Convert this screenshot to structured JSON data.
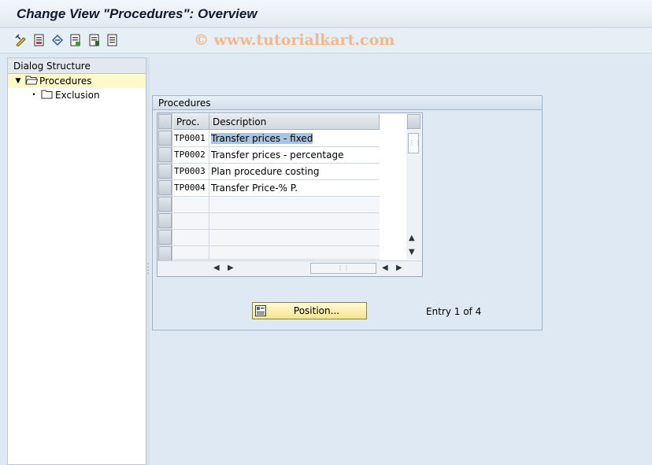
{
  "window": {
    "title": "Change View \"Procedures\": Overview"
  },
  "toolbar": {
    "watermark": "© www.tutorialkart.com",
    "buttons": [
      "display-change-icon",
      "new-entries-icon",
      "undo-change-icon",
      "copy-as-icon",
      "delete-icon",
      "select-all-icon"
    ]
  },
  "dialog_structure": {
    "header": "Dialog Structure",
    "items": [
      {
        "label": "Procedures",
        "expanded": true,
        "selected": true
      },
      {
        "label": "Exclusion",
        "expanded": false,
        "selected": false
      }
    ]
  },
  "procedures": {
    "group_title": "Procedures",
    "columns": [
      "Proc.",
      "Description"
    ],
    "rows": [
      {
        "proc": "TP0001",
        "description": "Transfer prices - fixed"
      },
      {
        "proc": "TP0002",
        "description": "Transfer prices - percentage"
      },
      {
        "proc": "TP0003",
        "description": "Plan procedure costing"
      },
      {
        "proc": "TP0004",
        "description": "Transfer Price-% P."
      }
    ],
    "position_button": "Position...",
    "entry_info": "Entry 1 of 4"
  },
  "colors": {
    "selected_tree_bg": "#fff8c8",
    "highlight": "#a9c4e3",
    "button_bg": "#f5e48c"
  }
}
